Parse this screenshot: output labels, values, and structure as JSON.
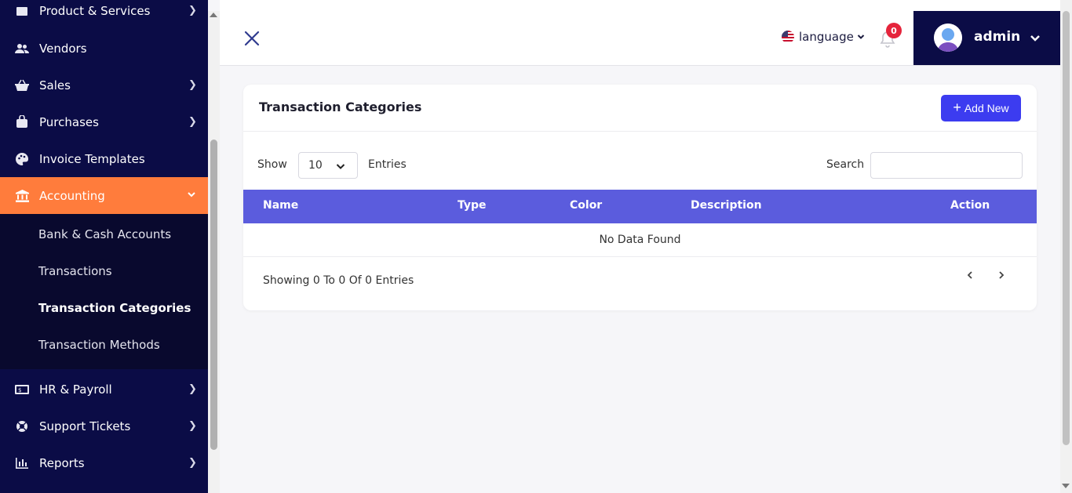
{
  "sidebar": {
    "items": [
      {
        "label": "Product & Services",
        "icon": "box-icon"
      },
      {
        "label": "Vendors",
        "icon": "users-icon"
      },
      {
        "label": "Sales",
        "icon": "basket-icon"
      },
      {
        "label": "Purchases",
        "icon": "bag-icon"
      },
      {
        "label": "Invoice Templates",
        "icon": "palette-icon"
      },
      {
        "label": "Accounting",
        "icon": "bank-icon"
      },
      {
        "label": "HR & Payroll",
        "icon": "money-icon"
      },
      {
        "label": "Support Tickets",
        "icon": "lifebuoy-icon"
      },
      {
        "label": "Reports",
        "icon": "bar-chart-icon"
      }
    ],
    "accounting_submenu": [
      "Bank & Cash Accounts",
      "Transactions",
      "Transaction Categories",
      "Transaction Methods"
    ],
    "active_color": "#ff7c3c",
    "bg_color": "#0b0c46"
  },
  "header": {
    "language_label": "language",
    "notification_count": "0",
    "user_name": "admin"
  },
  "card": {
    "title": "Transaction Categories",
    "add_button": "Add New",
    "show_label": "Show",
    "entries_value": "10",
    "entries_label": "Entries",
    "search_label": "Search",
    "search_value": "",
    "columns": [
      "Name",
      "Type",
      "Color",
      "Description",
      "Action"
    ],
    "empty_text": "No Data Found",
    "showing_text": "Showing 0 To 0 Of 0 Entries"
  },
  "colors": {
    "table_header": "#5b5cdd",
    "primary_button": "#3c3cf0"
  }
}
